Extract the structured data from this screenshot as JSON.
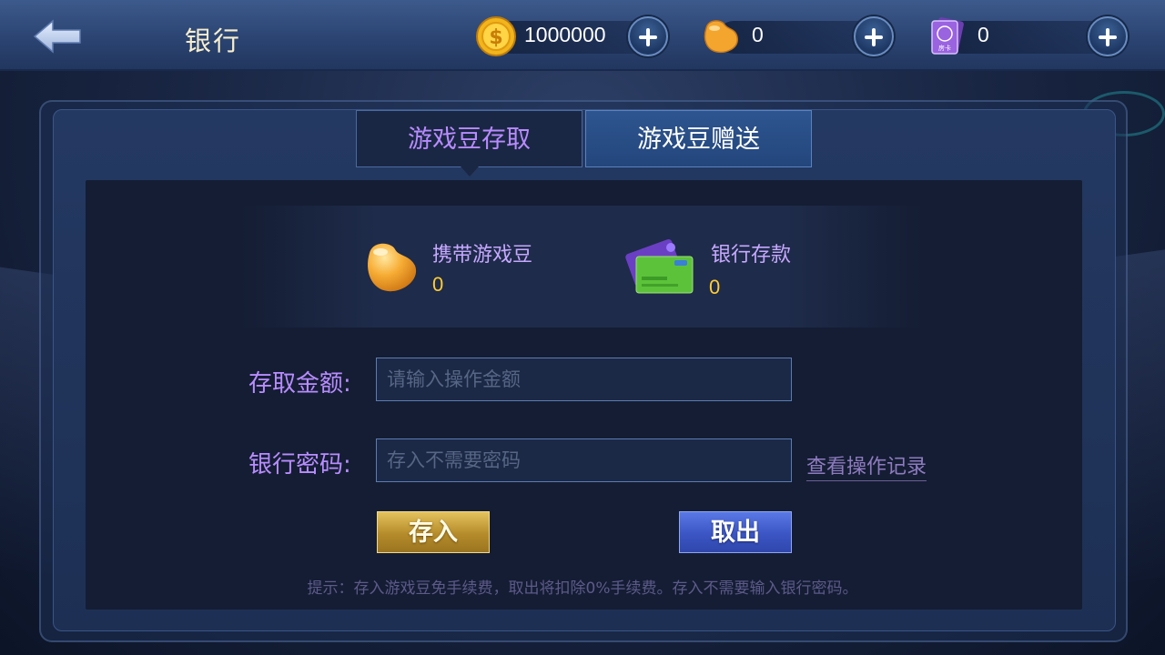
{
  "header": {
    "title": "银行",
    "gold": {
      "value": "1000000",
      "icon": "gold-coin-icon"
    },
    "beans": {
      "value": "0",
      "icon": "bean-icon"
    },
    "room_cards": {
      "value": "0",
      "icon": "room-card-icon",
      "icon_text": "房卡"
    }
  },
  "tabs": [
    {
      "label": "游戏豆存取",
      "active": true
    },
    {
      "label": "游戏豆赠送",
      "active": false
    }
  ],
  "balances": {
    "carry": {
      "label": "携带游戏豆",
      "value": "0"
    },
    "bank": {
      "label": "银行存款",
      "value": "0"
    }
  },
  "form": {
    "amount": {
      "label": "存取金额:",
      "placeholder": "请输入操作金额"
    },
    "password": {
      "label": "银行密码:",
      "placeholder": "存入不需要密码"
    },
    "history_link": "查看操作记录",
    "deposit_label": "存入",
    "withdraw_label": "取出"
  },
  "tip": "提示：存入游戏豆免手续费，取出将扣除0%手续费。存入不需要输入银行密码。",
  "colors": {
    "accent_purple": "#b88cff",
    "gold_text": "#ffcc33",
    "deposit_button": "#c9a13b",
    "withdraw_button": "#4a66d6"
  }
}
